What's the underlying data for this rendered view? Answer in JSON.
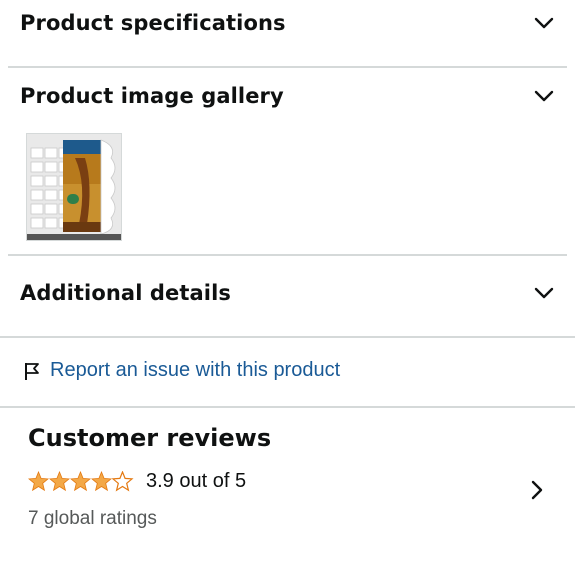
{
  "sections": {
    "specs_title": "Product specifications",
    "gallery_title": "Product image gallery",
    "details_title": "Additional details"
  },
  "gallery": {
    "thumbnail_icon": "product-packaging-thumbnail"
  },
  "report": {
    "label": "Report an issue with this product",
    "icon": "flag-icon",
    "color": "#1a5a96"
  },
  "reviews": {
    "title": "Customer reviews",
    "rating": 3.9,
    "max_rating": 5,
    "rating_text": "3.9 out of 5",
    "global_ratings": "7 global ratings",
    "star_color": "#f3a847"
  }
}
